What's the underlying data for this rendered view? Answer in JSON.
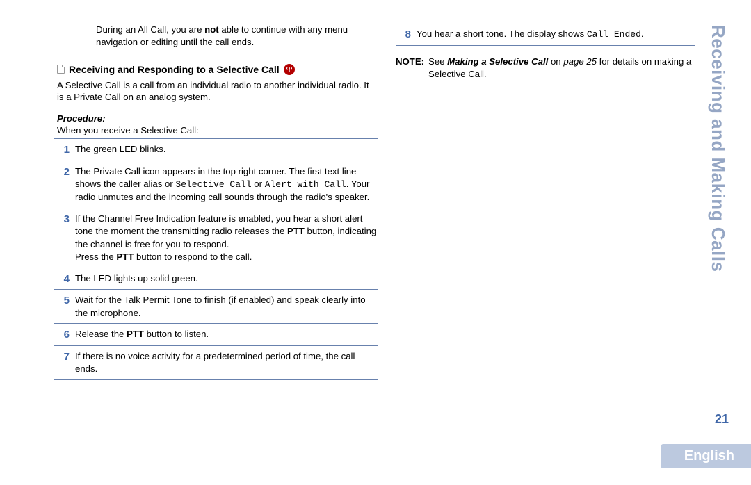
{
  "sidebar_title": "Receiving and Making Calls",
  "page_number": "21",
  "language": "English",
  "left": {
    "intro_pre": "During an All Call, you are ",
    "intro_bold": "not",
    "intro_post": " able to continue with any menu navigation or editing until the call ends.",
    "heading": "Receiving and Responding to a Selective Call",
    "desc": "A Selective Call is a call from an individual radio to another individual radio. It is a Private Call on an analog system.",
    "procedure_label": "Procedure:",
    "procedure_intro": "When you receive a Selective Call:",
    "steps": {
      "s1": {
        "n": "1",
        "t": "The green LED blinks."
      },
      "s2": {
        "n": "2",
        "pre": "The Private Call icon appears in the top right corner. The first text line shows the caller alias or ",
        "mono1": "Selective Call",
        "mid": " or ",
        "mono2": "Alert with Call",
        "post": ". Your radio unmutes and the incoming call sounds through the radio's speaker."
      },
      "s3": {
        "n": "3",
        "line1_pre": "If the Channel Free Indication feature is enabled, you hear a short alert tone the moment the transmitting radio releases the ",
        "line1_b": "PTT",
        "line1_post": " button, indicating the channel is free for you to respond.",
        "line2_pre": "Press the ",
        "line2_b": "PTT",
        "line2_post": " button to respond to the call."
      },
      "s4": {
        "n": "4",
        "t": "The LED lights up solid green."
      },
      "s5": {
        "n": "5",
        "t": "Wait for the Talk Permit Tone to finish (if enabled) and speak clearly into the microphone."
      },
      "s6": {
        "n": "6",
        "pre": "Release the ",
        "b": "PTT",
        "post": " button to listen."
      },
      "s7": {
        "n": "7",
        "t": "If there is no voice activity for a predetermined period of time, the call ends."
      }
    }
  },
  "right": {
    "step8": {
      "n": "8",
      "pre": "You hear a short tone. The display shows ",
      "mono": "Call Ended",
      "post": "."
    },
    "note": {
      "label": "NOTE:",
      "pre": "See ",
      "bi": "Making a Selective Call",
      "mid": " on ",
      "i": "page 25",
      "post": " for details on making a Selective Call."
    }
  }
}
